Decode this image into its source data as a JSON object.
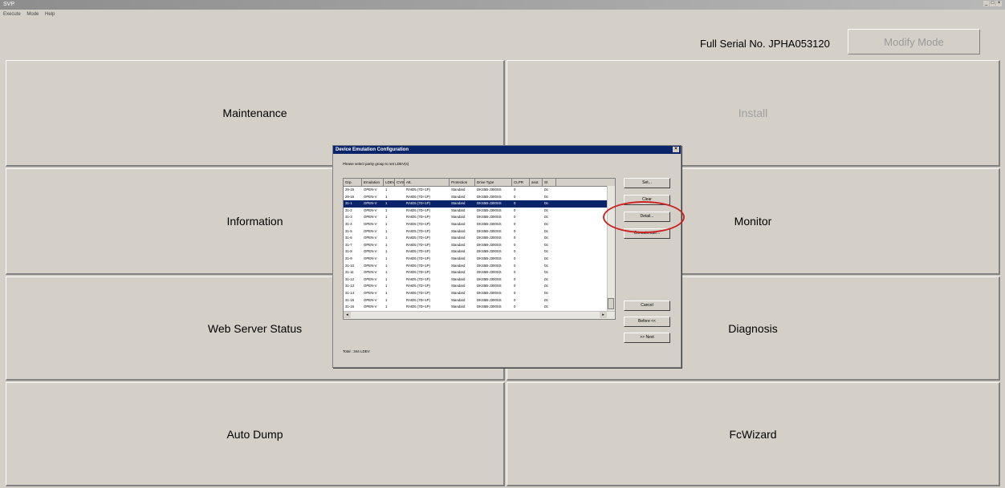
{
  "window": {
    "title": "SVP"
  },
  "menu": [
    "Execute",
    "Mode",
    "Help"
  ],
  "header": {
    "serial_label": "Full Serial No. JPHA053120",
    "modify_button": "Modify Mode"
  },
  "tiles": {
    "maintenance": "Maintenance",
    "install": "Install",
    "information": "Information",
    "monitor": "Monitor",
    "web_server_status": "Web Server Status",
    "diagnosis": "Diagnosis",
    "auto_dump": "Auto Dump",
    "fcwizard": "FcWizard"
  },
  "dialog": {
    "title": "Device Emulation Configuration",
    "prompt": "Please select parity group to set LDEV(s)",
    "columns": [
      "Grp.",
      "Emulation",
      "LDEV",
      "CVS",
      "Att.",
      "Protection",
      "Drive Type",
      "CLPR",
      "asst.",
      "St"
    ],
    "rows": [
      [
        "29-15",
        "OPEN-V",
        "1",
        "",
        "RAID5 (7D+1P)",
        "Standard",
        "DKS5B-J300SS",
        "0",
        "",
        "Dc"
      ],
      [
        "29-16",
        "OPEN-V",
        "1",
        "",
        "RAID5 (7D+1P)",
        "Standard",
        "DKS5B-J300SS",
        "0",
        "",
        "Dc"
      ],
      [
        "31-1",
        "OPEN-V",
        "1",
        "",
        "RAID5 (7D+1P)",
        "Standard",
        "DKS5B-J300SS",
        "0",
        "",
        "Dc"
      ],
      [
        "31-2",
        "OPEN-V",
        "1",
        "",
        "RAID5 (7D+1P)",
        "Standard",
        "DKS5B-J300SS",
        "0",
        "",
        "Dc"
      ],
      [
        "31-3",
        "OPEN-V",
        "1",
        "",
        "RAID5 (7D+1P)",
        "Standard",
        "DKS5B-J300SS",
        "0",
        "",
        "Dc"
      ],
      [
        "31-4",
        "OPEN-V",
        "1",
        "",
        "RAID5 (7D+1P)",
        "Standard",
        "DKS5B-J300SS",
        "0",
        "",
        "Dc"
      ],
      [
        "31-5",
        "OPEN-V",
        "1",
        "",
        "RAID5 (7D+1P)",
        "Standard",
        "DKS5B-J300SS",
        "0",
        "",
        "Dc"
      ],
      [
        "31-6",
        "OPEN-V",
        "1",
        "",
        "RAID5 (7D+1P)",
        "Standard",
        "DKS5B-J300SS",
        "0",
        "",
        "Dc"
      ],
      [
        "31-7",
        "OPEN-V",
        "1",
        "",
        "RAID5 (7D+1P)",
        "Standard",
        "DKS5B-J300SS",
        "0",
        "",
        "Dc"
      ],
      [
        "31-8",
        "OPEN-V",
        "1",
        "",
        "RAID5 (7D+1P)",
        "Standard",
        "DKS5B-J300SS",
        "0",
        "",
        "Dc"
      ],
      [
        "31-9",
        "OPEN-V",
        "1",
        "",
        "RAID5 (7D+1P)",
        "Standard",
        "DKS5B-J300SS",
        "0",
        "",
        "Dc"
      ],
      [
        "31-10",
        "OPEN-V",
        "1",
        "",
        "RAID5 (7D+1P)",
        "Standard",
        "DKS5B-J300SS",
        "0",
        "",
        "Dc"
      ],
      [
        "31-11",
        "OPEN-V",
        "1",
        "",
        "RAID5 (7D+1P)",
        "Standard",
        "DKS5B-J300SS",
        "0",
        "",
        "Dc"
      ],
      [
        "31-12",
        "OPEN-V",
        "1",
        "",
        "RAID5 (7D+1P)",
        "Standard",
        "DKS5B-J300SS",
        "0",
        "",
        "Dc"
      ],
      [
        "31-13",
        "OPEN-V",
        "1",
        "",
        "RAID5 (7D+1P)",
        "Standard",
        "DKS5B-J300SS",
        "0",
        "",
        "Dc"
      ],
      [
        "31-14",
        "OPEN-V",
        "1",
        "",
        "RAID5 (7D+1P)",
        "Standard",
        "DKS5B-J300SS",
        "0",
        "",
        "Dc"
      ],
      [
        "31-15",
        "OPEN-V",
        "1",
        "",
        "RAID5 (7D+1P)",
        "Standard",
        "DKS5B-J300SS",
        "0",
        "",
        "Dc"
      ],
      [
        "31-16",
        "OPEN-V",
        "1",
        "",
        "RAID5 (7D+1P)",
        "Standard",
        "DKS5B-J300SS",
        "0",
        "",
        "Dc"
      ]
    ],
    "selected_row": 2,
    "buttons": {
      "set": "Set...",
      "clear": "Clear",
      "detail": "Detail...",
      "concatenate": "Concatenate...",
      "cancel": "Cancel",
      "before": "Before <<",
      "next": ">> Next"
    },
    "total": "Total : 344 LDEV"
  },
  "colors": {
    "selection": "#0a246a",
    "highlight_circle": "#cc2222"
  }
}
